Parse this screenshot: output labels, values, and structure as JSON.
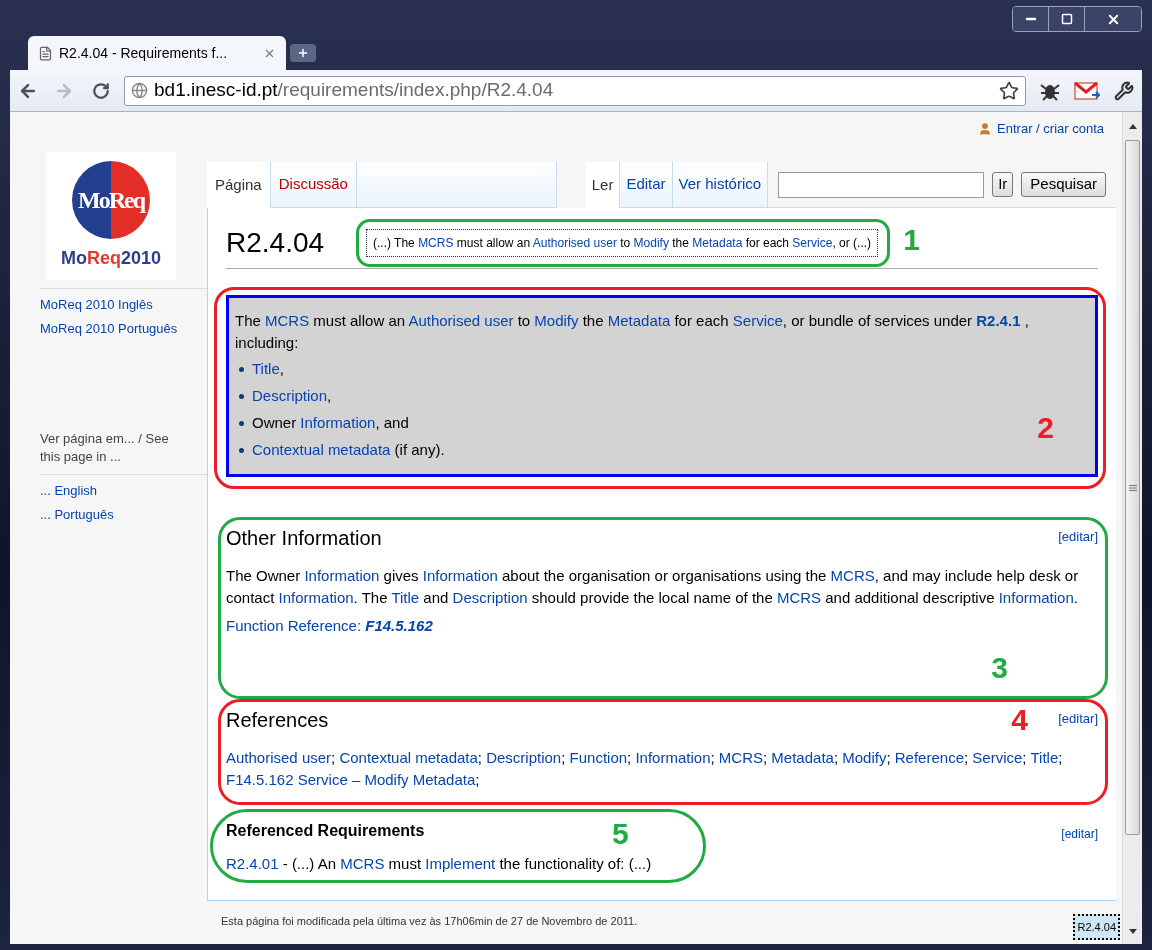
{
  "browser_tab": {
    "title": "R2.4.04 - Requirements f..."
  },
  "address_bar": {
    "host": "bd1.inesc-id.pt",
    "path": "/requirements/index.php/R2.4.04"
  },
  "user_link": "Entrar / criar conta",
  "logo": {
    "mark": "MoReq",
    "wordmark": [
      {
        "text": "Mo",
        "color": "#2c3e8c"
      },
      {
        "text": "Req",
        "color": "#e03a2c"
      },
      {
        "text": "2010",
        "color": "#2c3e8c"
      }
    ]
  },
  "sidebar": {
    "links": [
      "MoReq 2010 Inglês",
      "MoReq 2010 Português"
    ],
    "languages_heading": "Ver página em... / See this page in ...",
    "language_links": [
      "... English",
      "... Português"
    ]
  },
  "page_tabs": [
    {
      "label": "Página",
      "selected": true,
      "missing": false
    },
    {
      "label": "Discussão",
      "selected": false,
      "missing": true
    }
  ],
  "view_tabs": [
    {
      "label": "Ler",
      "selected": true
    },
    {
      "label": "Editar",
      "selected": false
    },
    {
      "label": "Ver histórico",
      "selected": false
    }
  ],
  "search": {
    "go_button": "Ir",
    "search_button": "Pesquisar"
  },
  "page_title": "R2.4.04",
  "summary": {
    "annotation": {
      "number": "1",
      "color": "#22aa44"
    },
    "segments": [
      "(...) The ",
      {
        "link": "MCRS"
      },
      " must allow an ",
      {
        "link": "Authorised user"
      },
      " to ",
      {
        "link": "Modify"
      },
      " the ",
      {
        "link": "Metadata"
      },
      " for each ",
      {
        "link": "Service"
      },
      ", or (...)"
    ]
  },
  "requirement": {
    "annotation": {
      "number": "2",
      "color": "#ee1c24"
    },
    "intro": [
      "The ",
      {
        "link": "MCRS"
      },
      " must allow an ",
      {
        "link": "Authorised user"
      },
      " to ",
      {
        "link": "Modify"
      },
      " the ",
      {
        "link": "Metadata"
      },
      " for each ",
      {
        "link": "Service"
      },
      ", or bundle of services under ",
      {
        "link": "R2.4.1",
        "bold": true
      },
      " , including:"
    ],
    "items": [
      [
        {
          "link": "Title"
        },
        ","
      ],
      [
        {
          "link": "Description"
        },
        ","
      ],
      [
        "Owner ",
        {
          "link": "Information"
        },
        ", and"
      ],
      [
        {
          "link": "Contextual metadata"
        },
        " (if any)."
      ]
    ]
  },
  "sections": [
    {
      "kind": "section",
      "heading": "Other Information",
      "edit": "[editar]",
      "annotation": {
        "number": "3",
        "color": "#22aa44"
      },
      "paragraphs": [
        [
          "The Owner ",
          {
            "link": "Information"
          },
          " gives ",
          {
            "link": "Information"
          },
          " about the organisation or organisations using the ",
          {
            "link": "MCRS"
          },
          ", and may include help desk or contact ",
          {
            "link": "Information"
          },
          ". The ",
          {
            "link": "Title"
          },
          " and ",
          {
            "link": "Description"
          },
          " should provide the local name of the ",
          {
            "link": "MCRS"
          },
          " and additional descriptive ",
          {
            "link": "Information"
          },
          "."
        ],
        [
          {
            "link": "Function Reference: "
          },
          {
            "link": "F14.5.162",
            "bold": true,
            "italic": true
          }
        ]
      ]
    },
    {
      "kind": "section",
      "heading": "References",
      "edit": "[editar]",
      "annotation": {
        "number": "4",
        "color": "#ee1c24"
      },
      "paragraphs": [
        [
          {
            "link": "Authorised user"
          },
          "; ",
          {
            "link": "Contextual metadata"
          },
          "; ",
          {
            "link": "Description"
          },
          "; ",
          {
            "link": "Function"
          },
          "; ",
          {
            "link": "Information"
          },
          "; ",
          {
            "link": "MCRS"
          },
          "; ",
          {
            "link": "Metadata"
          },
          "; ",
          {
            "link": "Modify"
          },
          "; ",
          {
            "link": "Reference"
          },
          "; ",
          {
            "link": "Service"
          },
          "; ",
          {
            "link": "Title"
          },
          "; ",
          {
            "link": "F14.5.162 Service – Modify Metadata"
          },
          ";"
        ]
      ]
    },
    {
      "kind": "subsection",
      "heading": "Referenced Requirements",
      "edit": "[editar]",
      "annotation": {
        "number": "5",
        "color": "#22aa44"
      },
      "paragraphs": [
        [
          {
            "link": "R2.4.01"
          },
          " - (...) An ",
          {
            "link": "MCRS"
          },
          " must ",
          {
            "link": "Implement"
          },
          " the functionality of: (...)"
        ]
      ]
    }
  ],
  "footer": "Esta página foi modificada pela última vez às 17h06min de 27 de Novembro de 2011.",
  "status_tooltip": "R2.4.04"
}
